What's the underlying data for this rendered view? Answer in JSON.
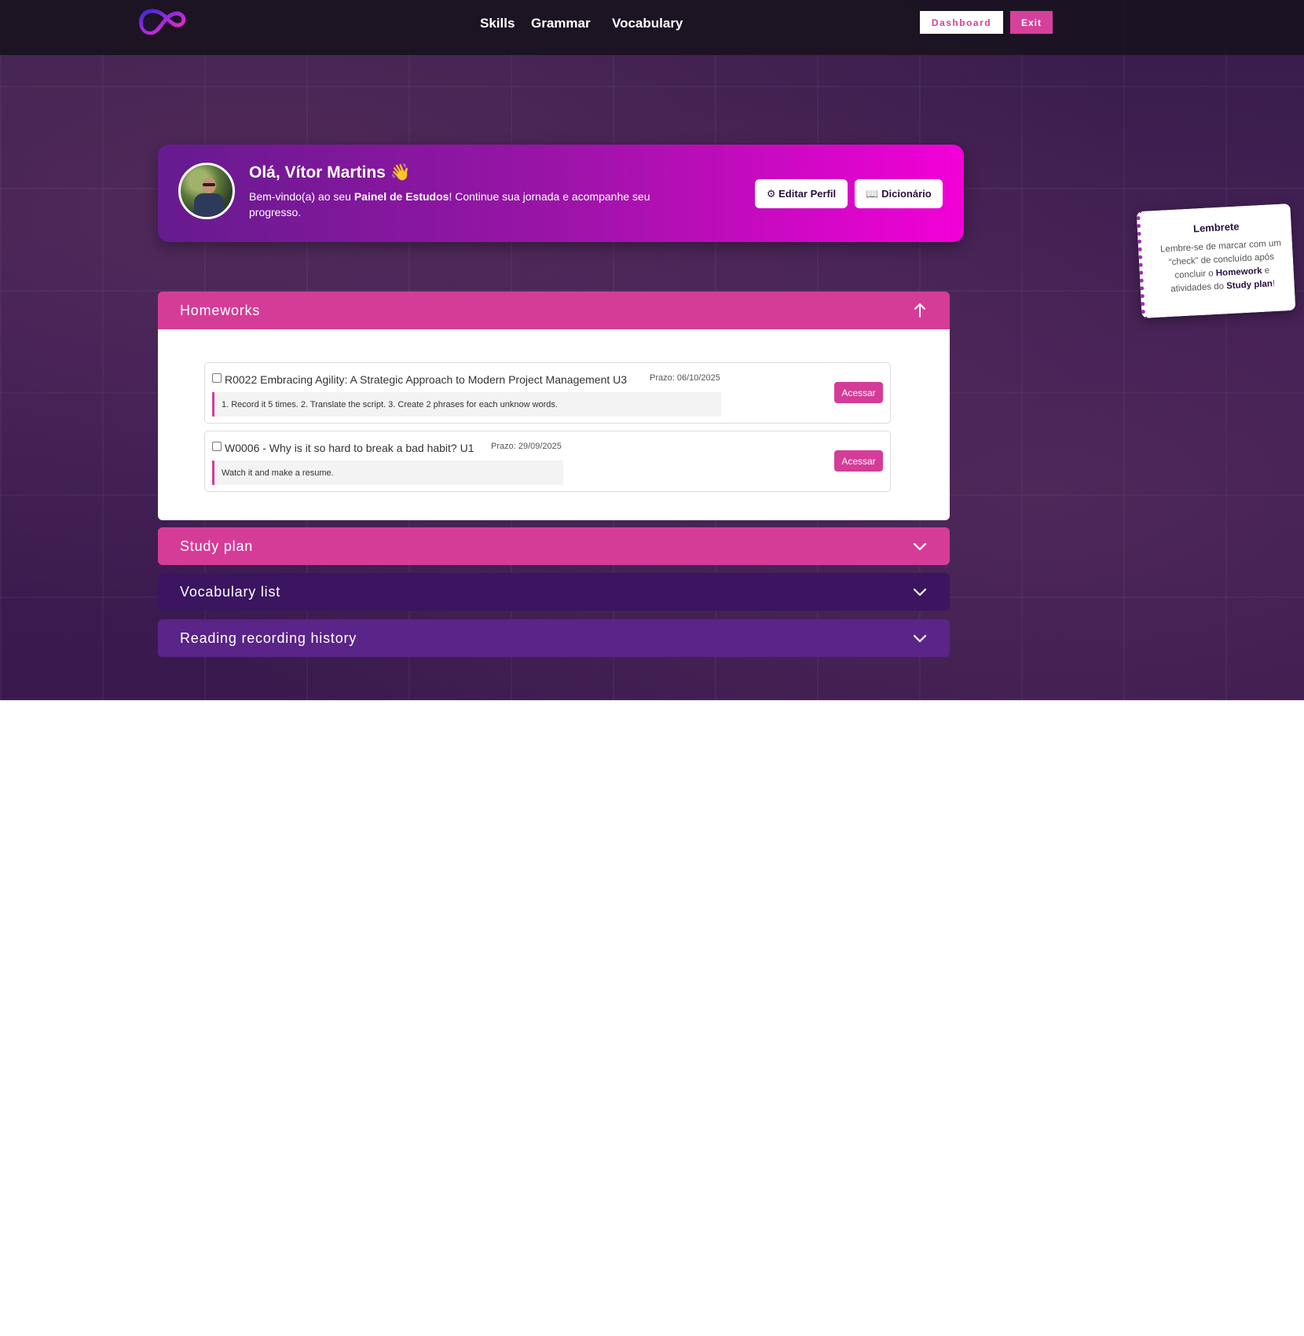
{
  "nav": {
    "logo": "infinity-logo",
    "links": [
      "Skills",
      "Grammar",
      "Vocabulary"
    ],
    "dashboard_label": "Dashboard",
    "exit_label": "Exit"
  },
  "profile": {
    "greeting": "Olá, Vítor Martins 👋",
    "welcome_prefix": "Bem-vindo(a) ao seu ",
    "welcome_bold": "Painel de Estudos",
    "welcome_suffix": "! Continue sua jornada e acompanhe seu progresso.",
    "edit_label": "⚙ Editar Perfil",
    "dict_label": "📖 Dicionário"
  },
  "accordions": {
    "homeworks": "Homeworks",
    "study_plan": "Study plan",
    "vocabulary": "Vocabulary list",
    "reading": "Reading recording history"
  },
  "homeworks": [
    {
      "title": "R0022 Embracing Agility: A Strategic Approach to Modern Project Management U3",
      "deadline": "Prazo: 06/10/2025",
      "description": "1. Record it 5 times. 2. Translate the script. 3. Create 2 phrases for each unknow words.",
      "action": "Acessar",
      "checked": false
    },
    {
      "title": "W0006 - Why is it so hard to break a bad habit? U1",
      "deadline": "Prazo: 29/09/2025",
      "description": "Watch it and make a resume.",
      "action": "Acessar",
      "checked": false
    }
  ],
  "reminder": {
    "title": "Lembrete",
    "text_1": "Lembre-se de marcar com um “check” de concluído após concluir o ",
    "bold_1": "Homework",
    "text_2": " e atividades do ",
    "bold_2": "Study plan",
    "text_3": "!"
  },
  "colors": {
    "accent_pink": "#d53c97",
    "deep_purple": "#3b1560",
    "purple": "#5a2488",
    "card_gradient_start": "#661b8f",
    "card_gradient_end": "#f300d8"
  }
}
